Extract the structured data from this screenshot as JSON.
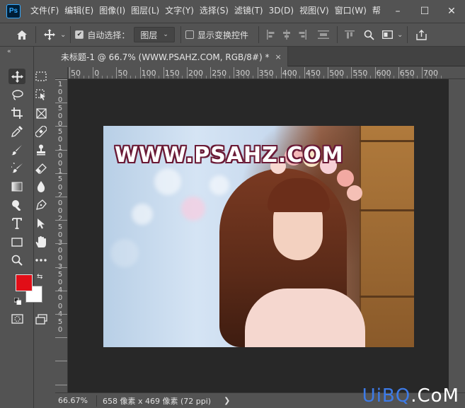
{
  "app": {
    "logo_text": "Ps"
  },
  "menu": {
    "items": [
      "文件(F)",
      "编辑(E)",
      "图像(I)",
      "图层(L)",
      "文字(Y)",
      "选择(S)",
      "滤镜(T)",
      "3D(D)",
      "视图(V)",
      "窗口(W)",
      "帮"
    ]
  },
  "window_controls": {
    "minimize": "–",
    "maximize": "☐",
    "close": "✕"
  },
  "options_bar": {
    "home_icon": "home-icon",
    "move_icon": "move-icon",
    "auto_select_label": "自动选择：",
    "auto_select_checked": true,
    "layer_select_value": "图层",
    "show_transform_label": "显示变换控件",
    "show_transform_checked": false
  },
  "document": {
    "tab_title": "未标题-1 @ 66.7% (WWW.PSAHZ.COM, RGB/8#) *",
    "tab_close": "×"
  },
  "ruler": {
    "top_labels": [
      "50",
      "0",
      "50",
      "100",
      "150",
      "200",
      "250",
      "300",
      "350",
      "400",
      "450",
      "500",
      "550",
      "600",
      "650",
      "700"
    ],
    "left_labels": [
      "1",
      "0",
      "0",
      "5",
      "0",
      "0",
      "5",
      "0",
      "1",
      "0",
      "0",
      "1",
      "5",
      "0",
      "2",
      "0",
      "0",
      "2",
      "5",
      "0",
      "3",
      "0",
      "0",
      "3",
      "5",
      "0",
      "4",
      "0",
      "0",
      "4",
      "5",
      "0"
    ]
  },
  "canvas": {
    "watermark": "WWW.PSAHZ.COM"
  },
  "colors": {
    "foreground": "#e10e17",
    "background": "#ffffff"
  },
  "status": {
    "zoom": "66.67%",
    "info": "658 像素 x 469 像素 (72 ppi)",
    "arrow": "❯"
  },
  "site_watermark": {
    "part1": "UiBQ",
    "part2": ".CoM"
  }
}
